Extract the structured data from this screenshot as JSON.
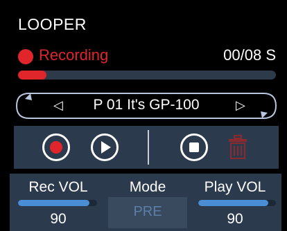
{
  "title": "LOOPER",
  "recording": {
    "label": "Recording",
    "time": "00/08 S",
    "progress_fraction": 0.11
  },
  "patch": {
    "prev_icon": "◁",
    "name": "P 01  It's GP-100",
    "next_icon": "▷"
  },
  "controls": {
    "record_icon": "record-icon",
    "play_icon": "play-icon",
    "stop_icon": "stop-icon",
    "delete_icon": "trash-icon"
  },
  "rec_vol": {
    "label": "Rec VOL",
    "value": "90",
    "level": 0.9
  },
  "mode": {
    "label": "Mode",
    "value": "PRE"
  },
  "play_vol": {
    "label": "Play VOL",
    "value": "90",
    "level": 0.9
  },
  "colors": {
    "accent_red": "#e0262a",
    "panel": "#2b3a4d",
    "slider": "#4a8ed6"
  }
}
